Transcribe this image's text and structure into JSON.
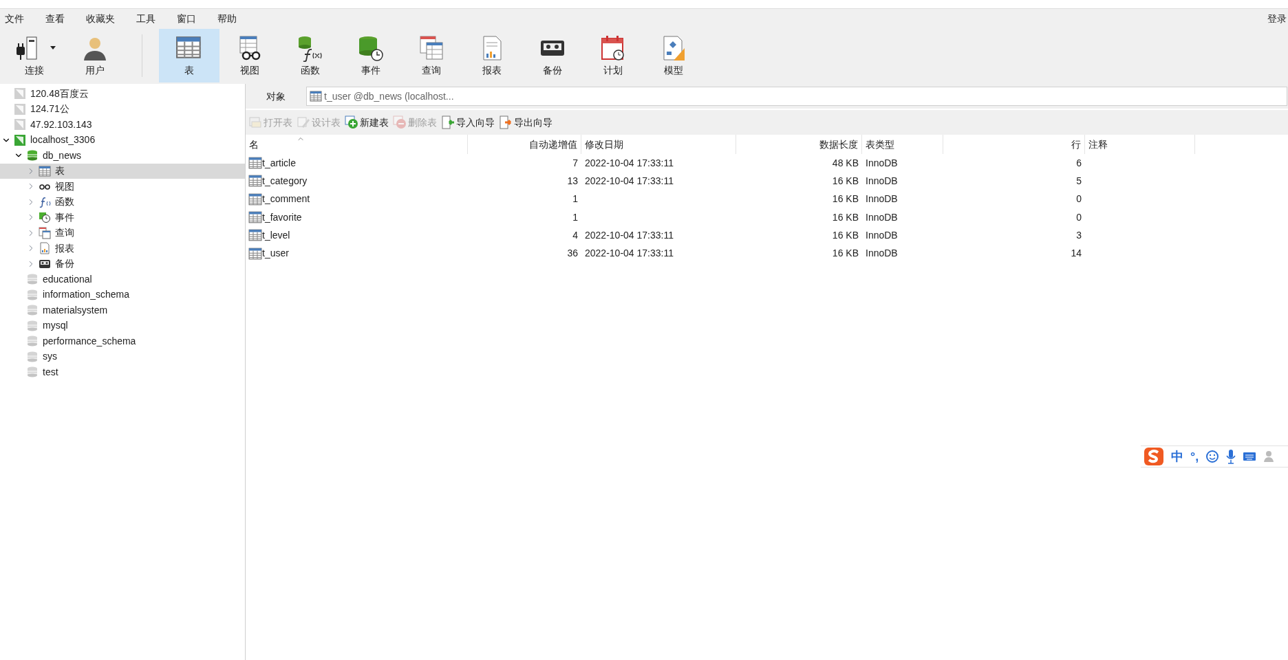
{
  "menu": {
    "items": [
      "文件",
      "查看",
      "收藏夹",
      "工具",
      "窗口",
      "帮助"
    ],
    "login": "登录"
  },
  "toolbar": {
    "left": [
      {
        "kind": "connection",
        "label": "连接",
        "selected": false,
        "dropdown": true
      },
      {
        "kind": "user",
        "label": "用户",
        "selected": false,
        "dropdown": false
      }
    ],
    "objects": [
      {
        "kind": "table",
        "label": "表",
        "selected": true
      },
      {
        "kind": "view",
        "label": "视图",
        "selected": false
      },
      {
        "kind": "function",
        "label": "函数",
        "selected": false
      },
      {
        "kind": "event",
        "label": "事件",
        "selected": false
      },
      {
        "kind": "query",
        "label": "查询",
        "selected": false
      },
      {
        "kind": "report",
        "label": "报表",
        "selected": false
      },
      {
        "kind": "backup",
        "label": "备份",
        "selected": false
      },
      {
        "kind": "schedule",
        "label": "计划",
        "selected": false
      },
      {
        "kind": "model",
        "label": "模型",
        "selected": false
      }
    ]
  },
  "sidebar": {
    "items": [
      {
        "kind": "connection",
        "label": "120.48百度云",
        "open": false,
        "selected": false
      },
      {
        "kind": "connection",
        "label": "124.71公",
        "open": false,
        "selected": false
      },
      {
        "kind": "connection",
        "label": "47.92.103.143",
        "open": false,
        "selected": false
      },
      {
        "kind": "connection",
        "label": "localhost_3306",
        "open": true,
        "expanded": true,
        "selected": false,
        "children": [
          {
            "kind": "database",
            "label": "db_news",
            "open": true,
            "expanded": true,
            "selected": false,
            "children": [
              {
                "kind": "table",
                "label": "表",
                "expanded": false,
                "selected": true
              },
              {
                "kind": "view",
                "label": "视图",
                "expanded": false,
                "selected": false
              },
              {
                "kind": "function",
                "label": "函数",
                "expanded": false,
                "selected": false
              },
              {
                "kind": "event",
                "label": "事件",
                "expanded": false,
                "selected": false
              },
              {
                "kind": "query",
                "label": "查询",
                "expanded": false,
                "selected": false
              },
              {
                "kind": "report",
                "label": "报表",
                "expanded": false,
                "selected": false
              },
              {
                "kind": "backup",
                "label": "备份",
                "expanded": false,
                "selected": false
              }
            ]
          },
          {
            "kind": "database",
            "label": "educational",
            "open": false,
            "selected": false
          },
          {
            "kind": "database",
            "label": "information_schema",
            "open": false,
            "selected": false
          },
          {
            "kind": "database",
            "label": "materialsystem",
            "open": false,
            "selected": false
          },
          {
            "kind": "database",
            "label": "mysql",
            "open": false,
            "selected": false
          },
          {
            "kind": "database",
            "label": "performance_schema",
            "open": false,
            "selected": false
          },
          {
            "kind": "database",
            "label": "sys",
            "open": false,
            "selected": false
          },
          {
            "kind": "database",
            "label": "test",
            "open": false,
            "selected": false
          }
        ]
      }
    ]
  },
  "tabs": [
    {
      "label": "对象",
      "selected": true
    }
  ],
  "object_field": {
    "value": "t_user @db_news (localhost..."
  },
  "object_toolbar": [
    {
      "kind": "open",
      "label": "打开表",
      "disabled": true
    },
    {
      "kind": "design",
      "label": "设计表",
      "disabled": true
    },
    {
      "kind": "new",
      "label": "新建表",
      "disabled": false
    },
    {
      "kind": "delete",
      "label": "删除表",
      "disabled": true
    },
    {
      "kind": "import",
      "label": "导入向导",
      "disabled": false
    },
    {
      "kind": "export",
      "label": "导出向导",
      "disabled": false
    }
  ],
  "table": {
    "columns": [
      {
        "label": "名",
        "kind": "name",
        "sorted": true
      },
      {
        "label": "自动递增值",
        "kind": "number",
        "sorted": false
      },
      {
        "label": "修改日期",
        "kind": "text",
        "sorted": false
      },
      {
        "label": "数据长度",
        "kind": "number",
        "sorted": false
      },
      {
        "label": "表类型",
        "kind": "text",
        "sorted": false
      },
      {
        "label": "行",
        "kind": "number",
        "sorted": false
      },
      {
        "label": "注释",
        "kind": "text",
        "sorted": false
      }
    ],
    "rows": [
      [
        "t_article",
        "7",
        "2022-10-04 17:33:11",
        "48 KB",
        "InnoDB",
        "6",
        null
      ],
      [
        "t_category",
        "13",
        "2022-10-04 17:33:11",
        "16 KB",
        "InnoDB",
        "5",
        null
      ],
      [
        "t_comment",
        "1",
        null,
        "16 KB",
        "InnoDB",
        "0",
        null
      ],
      [
        "t_favorite",
        "1",
        null,
        "16 KB",
        "InnoDB",
        "0",
        null
      ],
      [
        "t_level",
        "4",
        "2022-10-04 17:33:11",
        "16 KB",
        "InnoDB",
        "3",
        null
      ],
      [
        "t_user",
        "36",
        "2022-10-04 17:33:11",
        "16 KB",
        "InnoDB",
        "14",
        null
      ]
    ]
  },
  "ime_bar": {
    "mode": "中",
    "punctuation": "°,"
  }
}
